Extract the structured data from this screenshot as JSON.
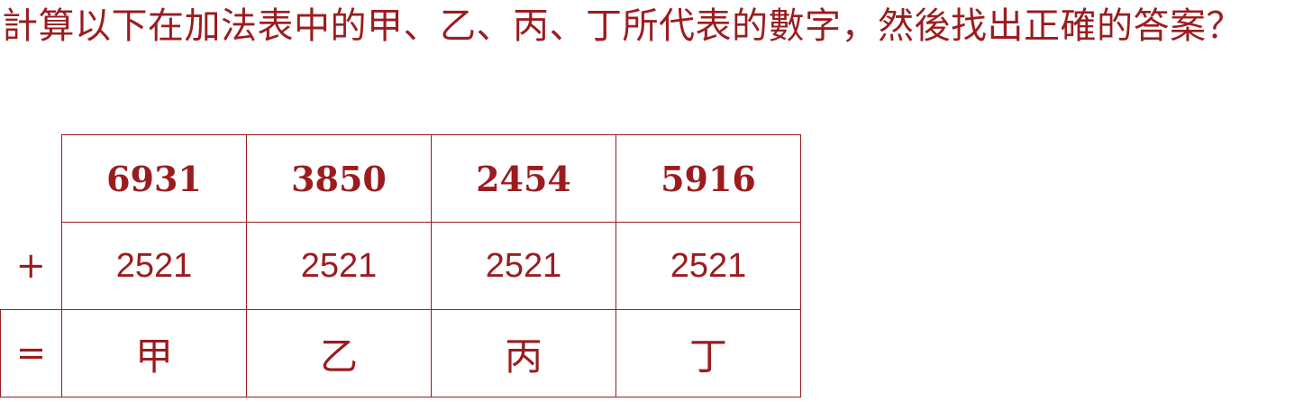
{
  "question": "計算以下在加法表中的甲、乙、丙、丁所代表的數字，然後找出正確的答案？",
  "table": {
    "plus_sign": "+",
    "equals_sign": "=",
    "top_numbers": [
      "6931",
      "3850",
      "2454",
      "5916"
    ],
    "addends": [
      "2521",
      "2521",
      "2521",
      "2521"
    ],
    "unknowns": [
      "甲",
      "乙",
      "丙",
      "丁"
    ]
  },
  "colors": {
    "text": "#9b1c1f",
    "background": "#ffffff"
  }
}
